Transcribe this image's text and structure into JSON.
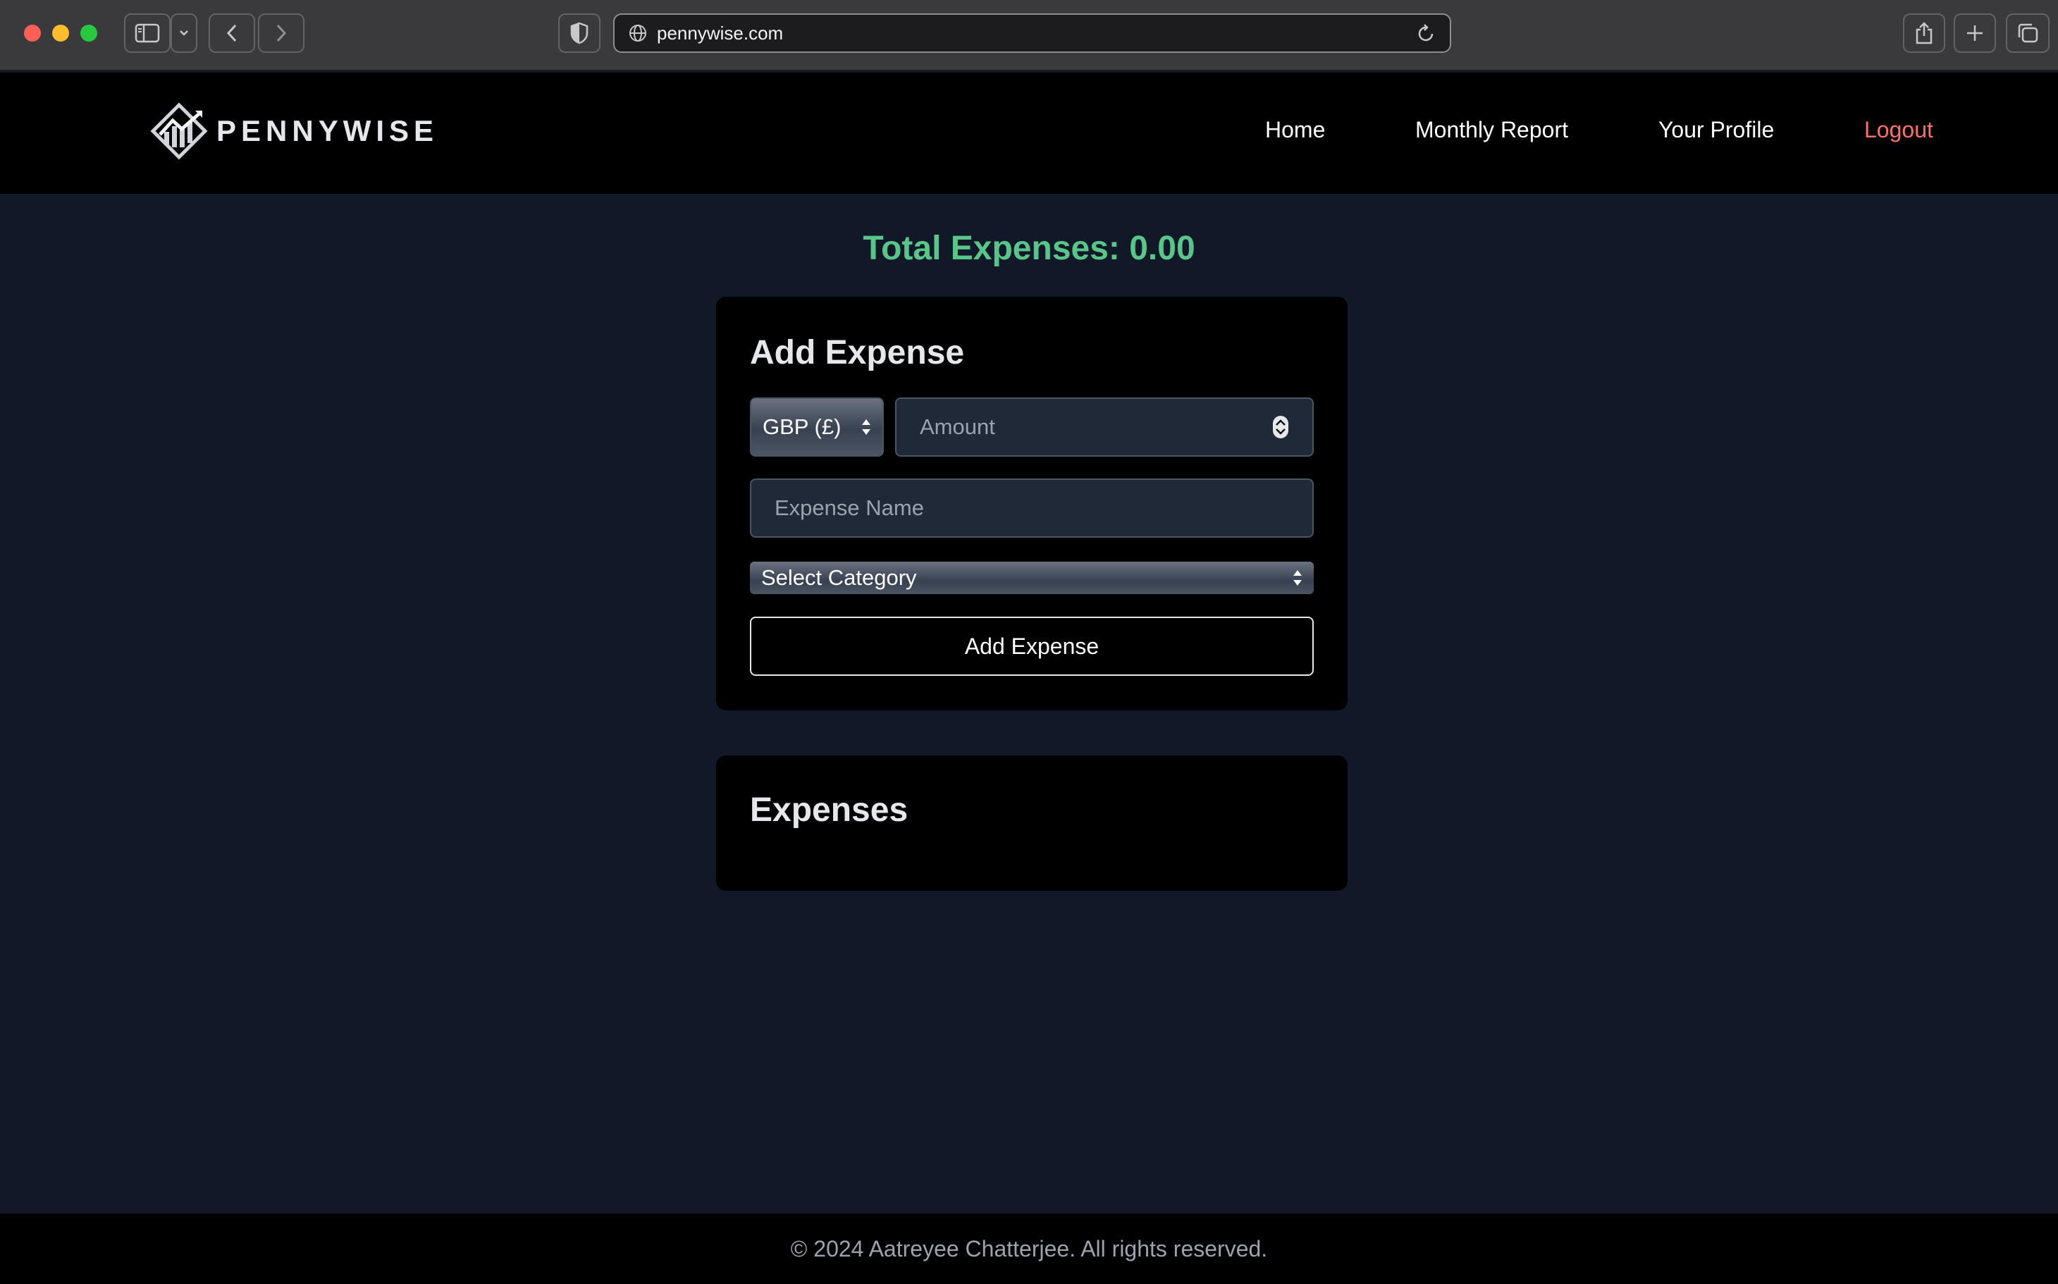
{
  "browser": {
    "url": "pennywise.com"
  },
  "header": {
    "logo_text": "PENNYWISE",
    "nav": [
      {
        "label": "Home"
      },
      {
        "label": "Monthly Report"
      },
      {
        "label": "Your Profile"
      },
      {
        "label": "Logout"
      }
    ]
  },
  "summary": {
    "total_label": "Total Expenses: 0.00"
  },
  "add_expense": {
    "title": "Add Expense",
    "currency_selected": "GBP (£)",
    "amount_placeholder": "Amount",
    "name_placeholder": "Expense Name",
    "category_selected": "Select Category",
    "submit_label": "Add Expense"
  },
  "expenses": {
    "title": "Expenses",
    "items": []
  },
  "footer": {
    "text": "© 2024 Aatreyee Chatterjee. All rights reserved."
  },
  "colors": {
    "page_bg": "#111827",
    "card_bg": "#000000",
    "total_green": "#5ac58a",
    "logout_red": "#f87171"
  }
}
